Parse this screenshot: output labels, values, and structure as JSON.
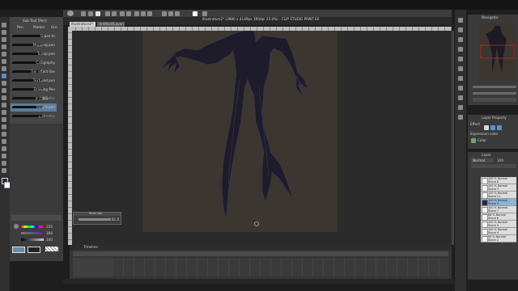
{
  "window": {
    "title": "Illustration2* (3980 x 4149px 300dpi 25.0%) - CLIP STUDIO PAINT EX"
  },
  "sub_tool": {
    "header": "Sub Tool [Pen]",
    "tabs": [
      "Pen",
      "Marker",
      "Gro"
    ],
    "brushes": [
      "G-pen to",
      "Mapping pen",
      "Turnip pen",
      "Calligraphy",
      "Tier effect line",
      "Textured pen",
      "Drawing Pen",
      "ラフ描画ペン",
      "Real G-pen",
      "レバーペン"
    ]
  },
  "canvas_tabs": [
    "Illustration2*",
    "Untitled(Layer)"
  ],
  "navigator": {
    "title": "Navigator"
  },
  "color_panel": {
    "values": [
      "255",
      "166",
      "100"
    ]
  },
  "layer_properties": {
    "title": "Layer Property",
    "effect_label": "Effect",
    "expression_color": "Expression color",
    "color_value": "Color"
  },
  "layer_panel": {
    "tab": "Layer",
    "blend_mode": "Normal",
    "opacity": "100",
    "layers": [
      {
        "mode": "100 % Normal",
        "name": "Stone 8"
      },
      {
        "mode": "100 % Normal",
        "name": "Stone 7"
      },
      {
        "mode": "100 % Normal",
        "name": "Stone 11"
      },
      {
        "mode": "100 % Normal",
        "name": "Stone 5"
      },
      {
        "mode": "100 % Normal",
        "name": "Stone 7"
      },
      {
        "mode": "86 % Normal",
        "name": "Stone 8"
      },
      {
        "mode": "100 % Normal",
        "name": "Stone 3"
      },
      {
        "mode": "100 % Normal",
        "name": "Stone 4"
      },
      {
        "mode": "90 % Normal",
        "name": "Stone 2"
      }
    ]
  },
  "brush_size_popup": {
    "title": "Brush size",
    "value": "81.0"
  },
  "timeline": {
    "title": "Timeline"
  },
  "colors": {
    "canvas_bg": "#3b3630",
    "workspace": "#2b2b2b",
    "selected_layer": "#8db4d6",
    "accent_red": "#cc2222"
  }
}
